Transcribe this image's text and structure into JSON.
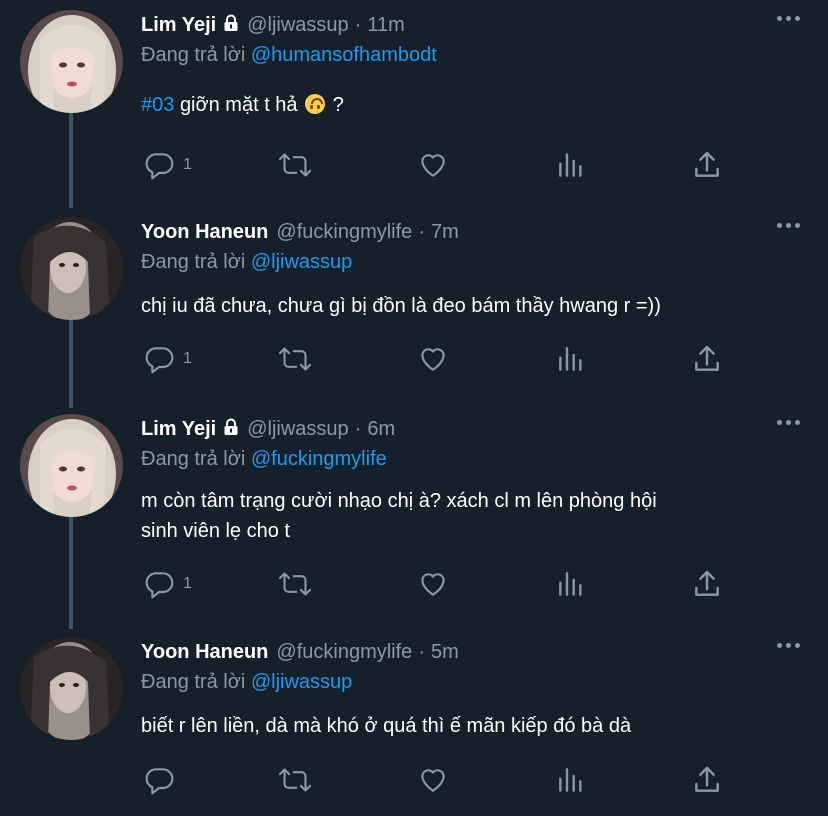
{
  "tweets": [
    {
      "name": "Lim Yeji",
      "locked": true,
      "handle": "@ljiwassup",
      "time": "11m",
      "replying_prefix": "Đang trả lời",
      "replying_to": "@humansofhambodt",
      "text_hashtag": "#03",
      "text": "giỡn mặt t hả",
      "text_suffix": "?",
      "emoji": "upside-down-face",
      "reply_count": "1"
    },
    {
      "name": "Yoon Haneun",
      "locked": false,
      "handle": "@fuckingmylife",
      "time": "7m",
      "replying_prefix": "Đang trả lời",
      "replying_to": "@ljiwassup",
      "text": "chị iu đã chưa, chưa gì bị đồn là đeo bám thầy hwang r =))",
      "reply_count": "1"
    },
    {
      "name": "Lim Yeji",
      "locked": true,
      "handle": "@ljiwassup",
      "time": "6m",
      "replying_prefix": "Đang trả lời",
      "replying_to": "@fuckingmylife",
      "text_line1": "m còn tâm trạng cười nhạo chị à? xách cl m lên phòng hội",
      "text_line2": "sinh viên lẹ cho t",
      "reply_count": "1"
    },
    {
      "name": "Yoon Haneun",
      "locked": false,
      "handle": "@fuckingmylife",
      "time": "5m",
      "replying_prefix": "Đang trả lời",
      "replying_to": "@ljiwassup",
      "text": "biết r lên liền, dà mà khó ở quá thì ế mãn kiếp đó bà dà",
      "reply_count": ""
    }
  ],
  "colors": {
    "background": "#15202b",
    "accent": "#1d9bf0",
    "muted": "#8b98a5",
    "thread_line": "#3d5466"
  },
  "icons": [
    "reply-icon",
    "retweet-icon",
    "like-icon",
    "analytics-icon",
    "share-icon",
    "lock-icon",
    "more-icon"
  ]
}
